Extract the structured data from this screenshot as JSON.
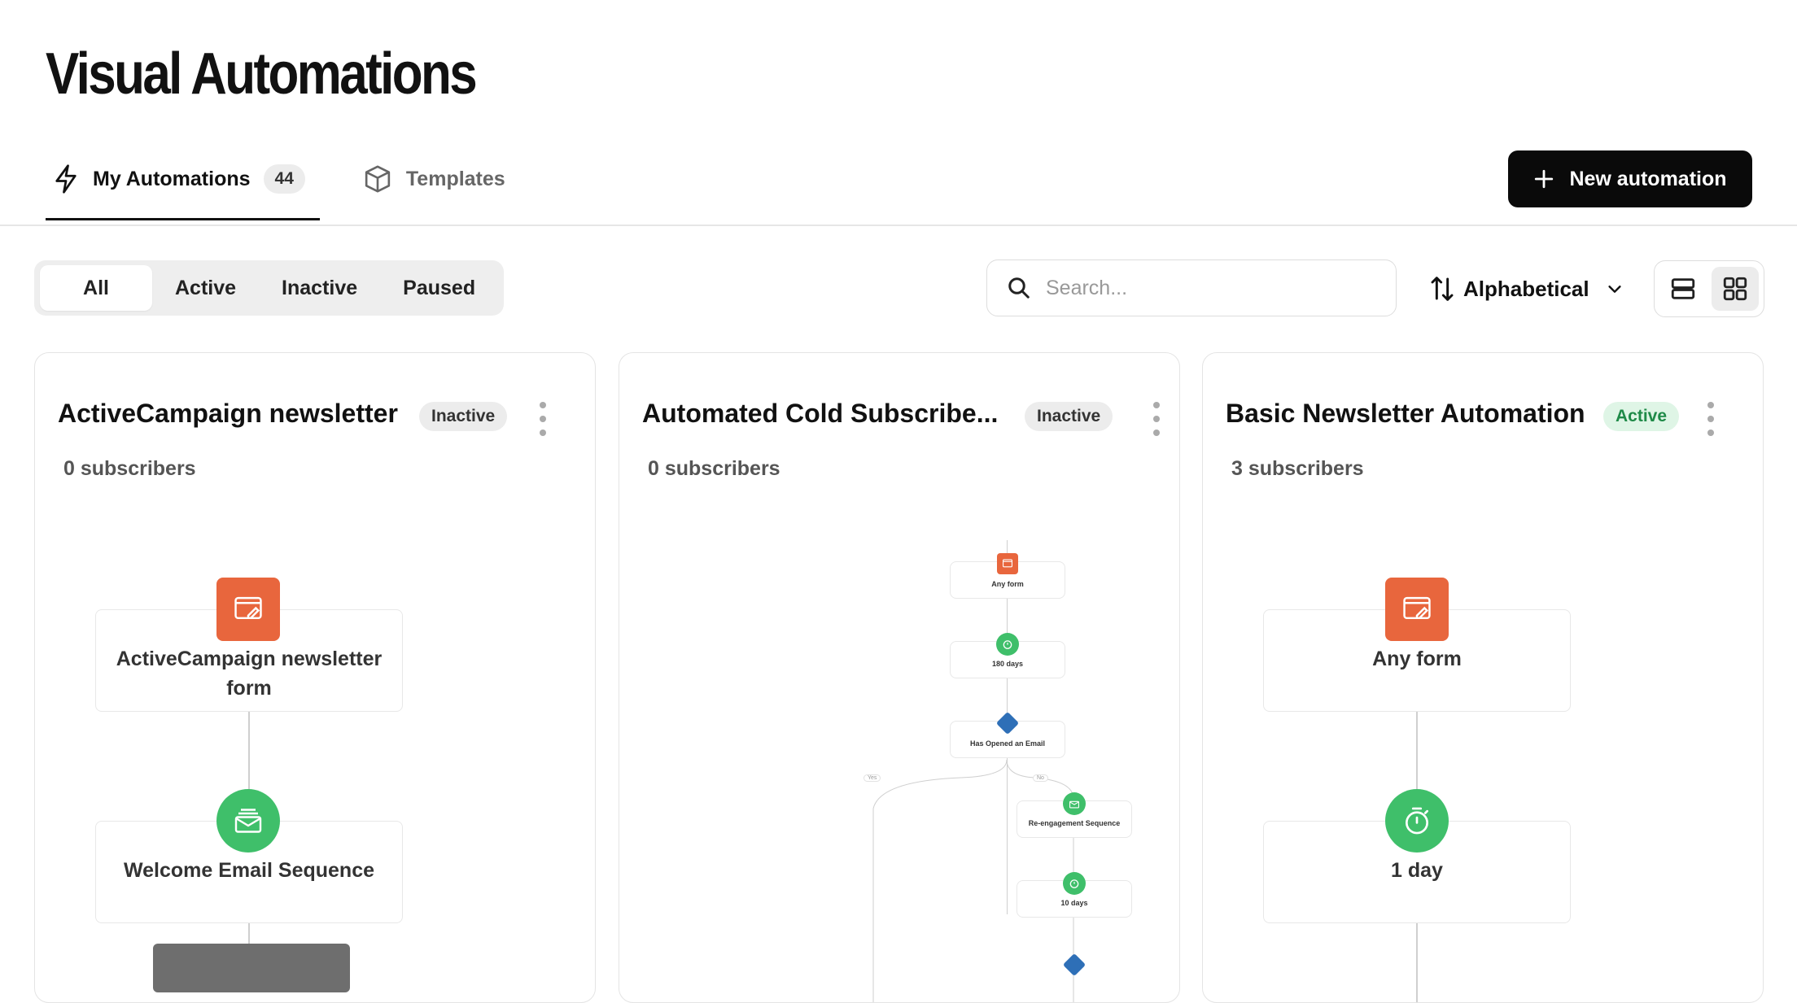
{
  "page": {
    "title": "Visual Automations"
  },
  "tabs": {
    "my_automations": {
      "label": "My Automations",
      "count": "44"
    },
    "templates": {
      "label": "Templates"
    }
  },
  "actions": {
    "new_automation": "New automation"
  },
  "filters": {
    "items": [
      "All",
      "Active",
      "Inactive",
      "Paused"
    ],
    "selected": "All"
  },
  "search": {
    "placeholder": "Search...",
    "value": ""
  },
  "sort": {
    "label": "Alphabetical"
  },
  "view": {
    "selected": "grid"
  },
  "colors": {
    "trigger": "#e8663d",
    "action": "#3fbf6a",
    "condition": "#2e6fb7",
    "active_badge": "#1f8a48"
  },
  "cards": [
    {
      "title": "ActiveCampaign newsletter",
      "status": "Inactive",
      "subscribers": "0 subscribers",
      "nodes": [
        {
          "icon": "form-icon",
          "label_line1": "ActiveCampaign newsletter",
          "label_line2": "form"
        },
        {
          "icon": "email-sequence-icon",
          "label_line1": "Welcome Email Sequence"
        }
      ]
    },
    {
      "title": "Automated Cold Subscribe...",
      "status": "Inactive",
      "subscribers": "0 subscribers",
      "nodes": [
        {
          "icon": "form-icon",
          "label": "Any form"
        },
        {
          "icon": "timer-icon",
          "label": "180 days"
        },
        {
          "icon": "condition-icon",
          "label": "Has Opened an Email"
        },
        {
          "icon": "email-sequence-icon",
          "label": "Re-engagement Sequence"
        },
        {
          "icon": "timer-icon",
          "label": "10 days"
        }
      ],
      "branches": {
        "yes": "Yes",
        "no": "No"
      }
    },
    {
      "title": "Basic Newsletter Automation",
      "status": "Active",
      "subscribers": "3 subscribers",
      "nodes": [
        {
          "icon": "form-icon",
          "label": "Any form"
        },
        {
          "icon": "timer-icon",
          "label": "1 day"
        }
      ]
    }
  ]
}
